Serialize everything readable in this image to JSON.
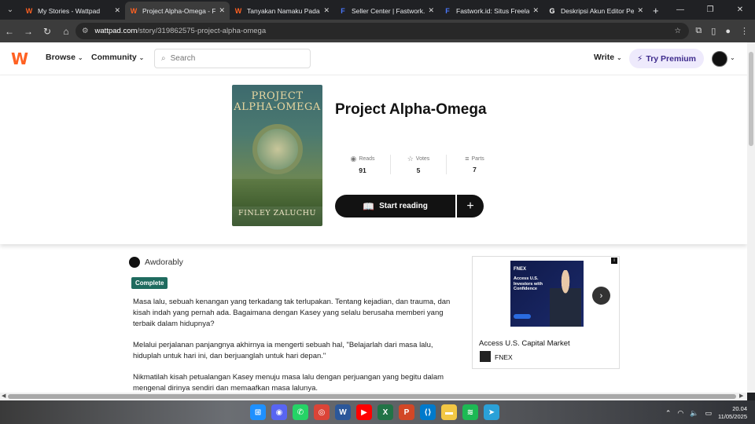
{
  "browser": {
    "tabs": [
      {
        "title": "My Stories - Wattpad",
        "favicon": "W",
        "fav_color": "#ff6122",
        "active": false
      },
      {
        "title": "Project Alpha-Omega - Fin",
        "favicon": "W",
        "fav_color": "#ff6122",
        "active": true
      },
      {
        "title": "Tanyakan Namaku Pada Se",
        "favicon": "W",
        "fav_color": "#ff6122",
        "active": false
      },
      {
        "title": "Seller Center | Fastwork.id",
        "favicon": "F",
        "fav_color": "#4a78ff",
        "active": false
      },
      {
        "title": "Fastwork.id: Situs Freelanc",
        "favicon": "F",
        "fav_color": "#4a78ff",
        "active": false
      },
      {
        "title": "Deskripsi Akun Editor Per",
        "favicon": "G",
        "fav_color": "#ffffff",
        "active": false
      }
    ],
    "url_host": "wattpad.com",
    "url_path": "/story/319862575-project-alpha-omega"
  },
  "header": {
    "browse": "Browse",
    "community": "Community",
    "search_placeholder": "Search",
    "write": "Write",
    "premium": "Try Premium"
  },
  "story": {
    "cover_title": "PROJECT ALPHA-OMEGA",
    "cover_author": "FINLEY ZALUCHU",
    "title": "Project Alpha-Omega",
    "stats": [
      {
        "label": "Reads",
        "value": "91",
        "icon": "eye-icon"
      },
      {
        "label": "Votes",
        "value": "5",
        "icon": "star-icon"
      },
      {
        "label": "Parts",
        "value": "7",
        "icon": "list-icon"
      }
    ],
    "start_reading": "Start reading",
    "add_label": "+",
    "author": "Awdorably",
    "status": "Complete",
    "description": [
      "Masa lalu, sebuah kenangan yang terkadang tak terlupakan. Tentang kejadian, dan trauma, dan kisah indah yang pernah ada. Bagaimana dengan Kasey yang selalu berusaha memberi yang terbaik dalam hidupnya?",
      "Melalui perjalanan panjangnya akhirnya ia mengerti sebuah hal, \"Belajarlah dari masa lalu, hiduplah untuk hari ini, dan berjuanglah untuk hari depan.\"",
      "Nikmatilah kisah petualangan Kasey menuju masa lalu dengan perjuangan yang begitu dalam mengenal dirinya sendiri dan memaafkan masa lalunya."
    ]
  },
  "ad": {
    "brand": "FNEX",
    "headline": "Access U.S. Investors with Confidence",
    "title": "Access U.S. Capital Market",
    "sponsor": "FNEX"
  },
  "taskbar": {
    "time": "20.04",
    "date": "11/05/2025"
  }
}
